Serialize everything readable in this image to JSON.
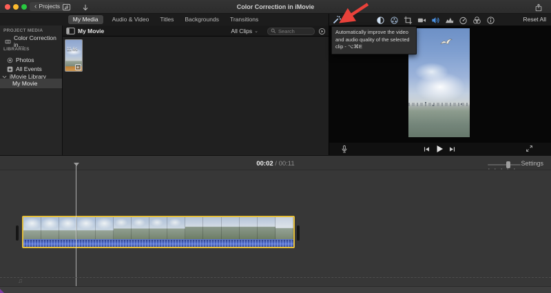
{
  "window": {
    "title": "Color Correction in iMovie",
    "back_button_label": "Projects"
  },
  "icons": {
    "back_chevron": "‹",
    "dropdown_chevron": "⌄",
    "music_note": "♫"
  },
  "media_tabs": {
    "items": [
      {
        "label": "My Media",
        "selected": true
      },
      {
        "label": "Audio & Video",
        "selected": false
      },
      {
        "label": "Titles",
        "selected": false
      },
      {
        "label": "Backgrounds",
        "selected": false
      },
      {
        "label": "Transitions",
        "selected": false
      }
    ]
  },
  "adjust_bar": {
    "reset_label": "Reset All",
    "icons": [
      "enhance-wand",
      "color-balance",
      "color-correction",
      "crop",
      "stabilization",
      "volume",
      "noise-reduction",
      "speed",
      "clip-filter",
      "info"
    ],
    "tooltip_text": "Automatically improve the video and audio quality of the selected clip - ⌥⌘E"
  },
  "sidebar": {
    "project_media_header": "PROJECT MEDIA",
    "project_item_label": "Color Correction in…",
    "libraries_header": "LIBRARIES",
    "items": [
      {
        "label": "Photos"
      },
      {
        "label": "All Events"
      }
    ],
    "imovie_library_label": "iMovie Library",
    "my_movie_label": "My Movie"
  },
  "browser": {
    "title": "My Movie",
    "filter_label": "All Clips",
    "search_placeholder": "Search",
    "clip_duration_badge": "11.6s",
    "clip_add_label": "+"
  },
  "timeline_bar": {
    "current_time": "00:02",
    "time_separator": "/",
    "total_time": "00:11",
    "settings_label": "Settings"
  },
  "colors": {
    "selection_yellow": "#e5bf3b",
    "arrow_red": "#e8413a",
    "volume_blue": "#4a90e2",
    "waveform_blue": "#3c55a8",
    "traffic_red": "#ff5f57",
    "traffic_yellow": "#febc2e",
    "traffic_green": "#28c840"
  }
}
